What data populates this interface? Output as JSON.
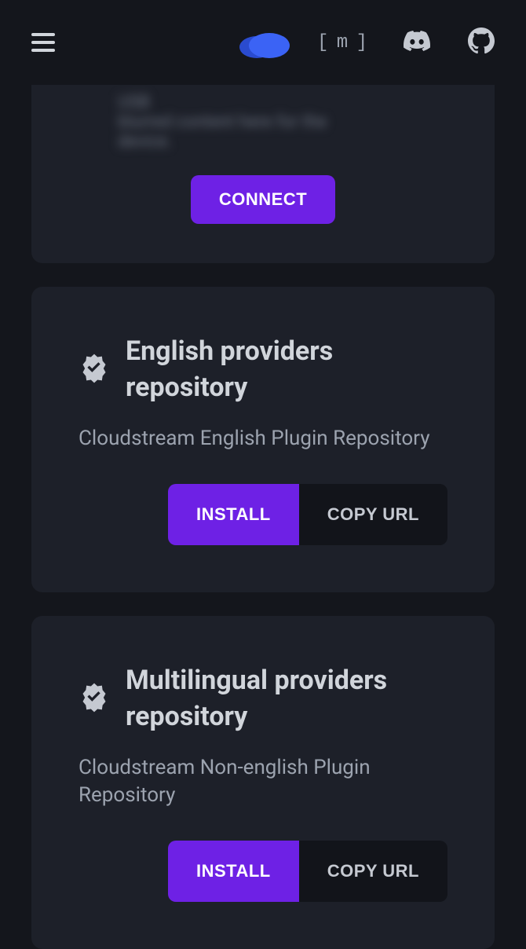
{
  "header": {
    "icons": {
      "menu": "hamburger-icon",
      "logo": "cloud-logo",
      "matrix": "matrix-icon",
      "discord": "discord-icon",
      "github": "github-icon"
    }
  },
  "connect_card": {
    "blurred_text_1": "USB",
    "blurred_text_2": "device.",
    "button_label": "CONNECT"
  },
  "repos": [
    {
      "title": "English providers repository",
      "subtitle": "Cloudstream English Plugin Repository",
      "install_label": "INSTALL",
      "copy_label": "COPY URL"
    },
    {
      "title": "Multilingual providers repository",
      "subtitle": "Cloudstream Non-english Plugin Repository",
      "install_label": "INSTALL",
      "copy_label": "COPY URL"
    }
  ]
}
